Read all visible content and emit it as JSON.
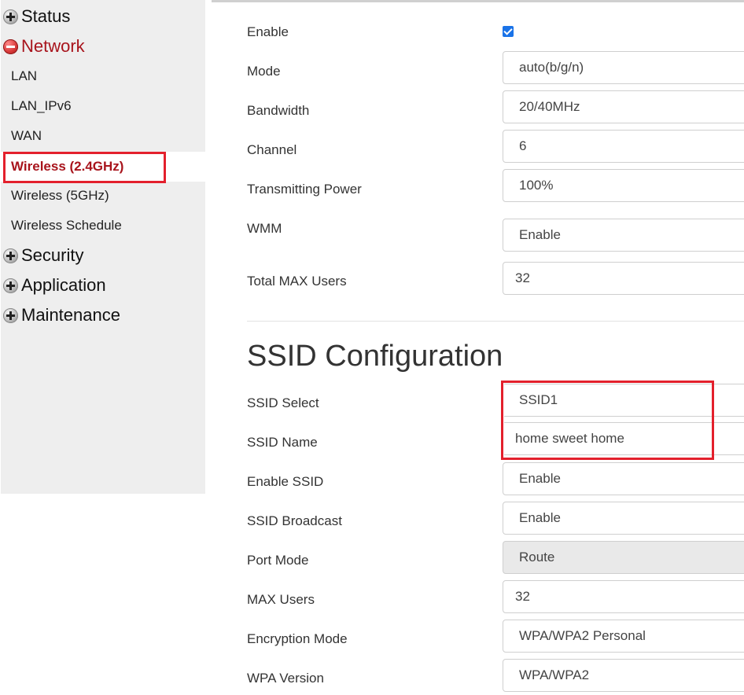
{
  "sidebar": {
    "sections": {
      "status": "Status",
      "network": "Network",
      "security": "Security",
      "application": "Application",
      "maintenance": "Maintenance"
    },
    "network_items": {
      "lan": "LAN",
      "lan_ipv6": "LAN_IPv6",
      "wan": "WAN",
      "wireless_24": "Wireless (2.4GHz)",
      "wireless_5": "Wireless (5GHz)",
      "wireless_schedule": "Wireless Schedule"
    }
  },
  "wireless": {
    "enable_label": "Enable",
    "enable_checked": true,
    "mode_label": "Mode",
    "mode_value": "auto(b/g/n)",
    "bandwidth_label": "Bandwidth",
    "bandwidth_value": "20/40MHz",
    "channel_label": "Channel",
    "channel_value": "6",
    "power_label": "Transmitting Power",
    "power_value": "100%",
    "wmm_label": "WMM",
    "wmm_value": "Enable",
    "max_users_label": "Total MAX Users",
    "max_users_value": "32"
  },
  "ssid": {
    "heading": "SSID Configuration",
    "select_label": "SSID Select",
    "select_value": "SSID1",
    "name_label": "SSID Name",
    "name_value": "home sweet home",
    "enable_label": "Enable SSID",
    "enable_value": "Enable",
    "broadcast_label": "SSID Broadcast",
    "broadcast_value": "Enable",
    "port_mode_label": "Port Mode",
    "port_mode_value": "Route",
    "max_users_label": "MAX Users",
    "max_users_value": "32",
    "encryption_label": "Encryption Mode",
    "encryption_value": "WPA/WPA2 Personal",
    "wpa_version_label": "WPA Version",
    "wpa_version_value": "WPA/WPA2"
  },
  "colors": {
    "accent_red": "#e3202c",
    "active_text": "#a8141c",
    "checkbox_blue": "#1a73e8",
    "sidebar_bg": "#eeeeee"
  }
}
